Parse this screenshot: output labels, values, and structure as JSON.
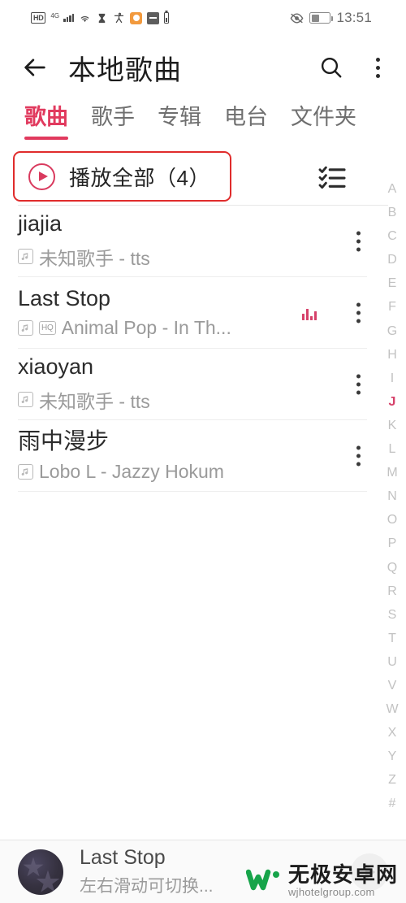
{
  "status_bar": {
    "hd_label": "HD",
    "network_label": "4G",
    "icons": [
      "hd-badge-icon",
      "signal-icon",
      "wifi-icon",
      "hourglass-icon",
      "accessibility-icon",
      "orange-app-icon",
      "dark-app-icon",
      "small-battery-icon",
      "eye-icon",
      "battery-icon"
    ],
    "time": "13:51"
  },
  "header": {
    "back_label": "←",
    "title": "本地歌曲",
    "search_label": "search",
    "more_label": "more"
  },
  "tabs": [
    {
      "label": "歌曲",
      "active": true
    },
    {
      "label": "歌手",
      "active": false
    },
    {
      "label": "专辑",
      "active": false
    },
    {
      "label": "电台",
      "active": false
    },
    {
      "label": "文件夹",
      "active": false
    }
  ],
  "play_all": {
    "label": "播放全部（4）",
    "count": 4,
    "highlight_color": "#e02c2c",
    "accent_color": "#d93a5e",
    "multi_select_label": "multi-select"
  },
  "songs": [
    {
      "title": "jiajia",
      "subtitle": "未知歌手 - tts",
      "badges": [
        "note"
      ],
      "playing": false,
      "title_cn": false
    },
    {
      "title": "Last Stop",
      "subtitle": "Animal Pop - In Th...",
      "badges": [
        "note",
        "HQ"
      ],
      "playing": true,
      "title_cn": false
    },
    {
      "title": "xiaoyan",
      "subtitle": "未知歌手 - tts",
      "badges": [
        "note"
      ],
      "playing": false,
      "title_cn": false
    },
    {
      "title": "雨中漫步",
      "subtitle": "Lobo L - Jazzy Hokum",
      "badges": [
        "note"
      ],
      "playing": false,
      "title_cn": true
    }
  ],
  "alpha_index": {
    "letters": [
      "A",
      "B",
      "C",
      "D",
      "E",
      "F",
      "G",
      "H",
      "I",
      "J",
      "K",
      "L",
      "M",
      "N",
      "O",
      "P",
      "Q",
      "R",
      "S",
      "T",
      "U",
      "V",
      "W",
      "X",
      "Y",
      "Z",
      "#"
    ],
    "active": "J",
    "active_color": "#d6416a"
  },
  "now_playing": {
    "title": "Last Stop",
    "subtitle": "左右滑动可切换...",
    "play_button_label": "play"
  },
  "watermark": {
    "cn": "无极安卓网",
    "en": "wjhotelgroup.com",
    "color": "#17a44a"
  },
  "theme": {
    "accent": "#e13a5e",
    "text_primary": "#2c2c2c",
    "text_secondary": "#9a9a9a"
  }
}
